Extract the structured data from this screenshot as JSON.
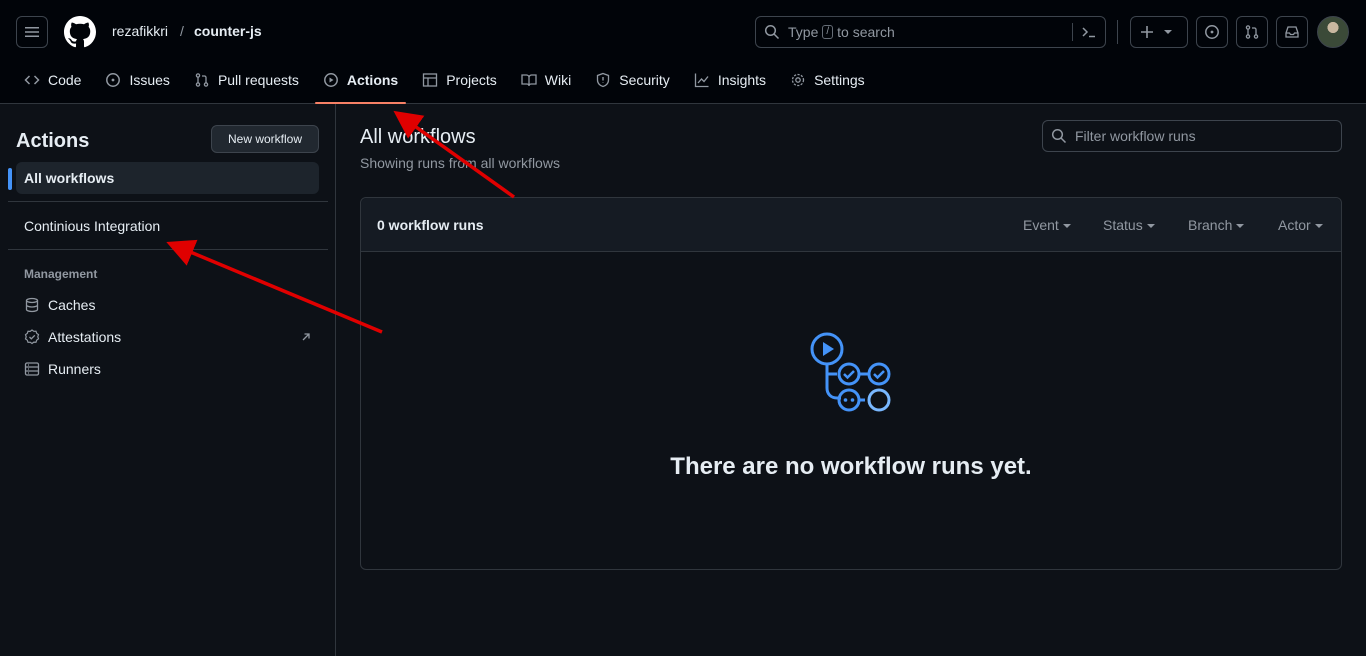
{
  "header": {
    "owner": "rezafikkri",
    "separator": "/",
    "repo": "counter-js",
    "search_prefix": "Type",
    "search_key": "/",
    "search_suffix": "to search"
  },
  "tabs": [
    {
      "label": "Code",
      "icon": "code-icon"
    },
    {
      "label": "Issues",
      "icon": "issue-icon"
    },
    {
      "label": "Pull requests",
      "icon": "pull-request-icon"
    },
    {
      "label": "Actions",
      "icon": "play-icon"
    },
    {
      "label": "Projects",
      "icon": "table-icon"
    },
    {
      "label": "Wiki",
      "icon": "book-icon"
    },
    {
      "label": "Security",
      "icon": "shield-icon"
    },
    {
      "label": "Insights",
      "icon": "graph-icon"
    },
    {
      "label": "Settings",
      "icon": "gear-icon"
    }
  ],
  "sidebar": {
    "title": "Actions",
    "new_workflow": "New workflow",
    "all_workflows": "All workflows",
    "workflow": "Continious Integration",
    "management": "Management",
    "items": [
      {
        "label": "Caches",
        "icon": "database-icon"
      },
      {
        "label": "Attestations",
        "icon": "verified-icon"
      },
      {
        "label": "Runners",
        "icon": "server-icon"
      }
    ]
  },
  "main": {
    "title": "All workflows",
    "subtitle": "Showing runs from all workflows",
    "filter_placeholder": "Filter workflow runs",
    "runs_count": "0 workflow runs",
    "filters": [
      "Event",
      "Status",
      "Branch",
      "Actor"
    ],
    "empty_message": "There are no workflow runs yet."
  },
  "colors": {
    "accent": "#4493f8",
    "tab_underline": "#f78166",
    "arrow": "#e00000"
  }
}
